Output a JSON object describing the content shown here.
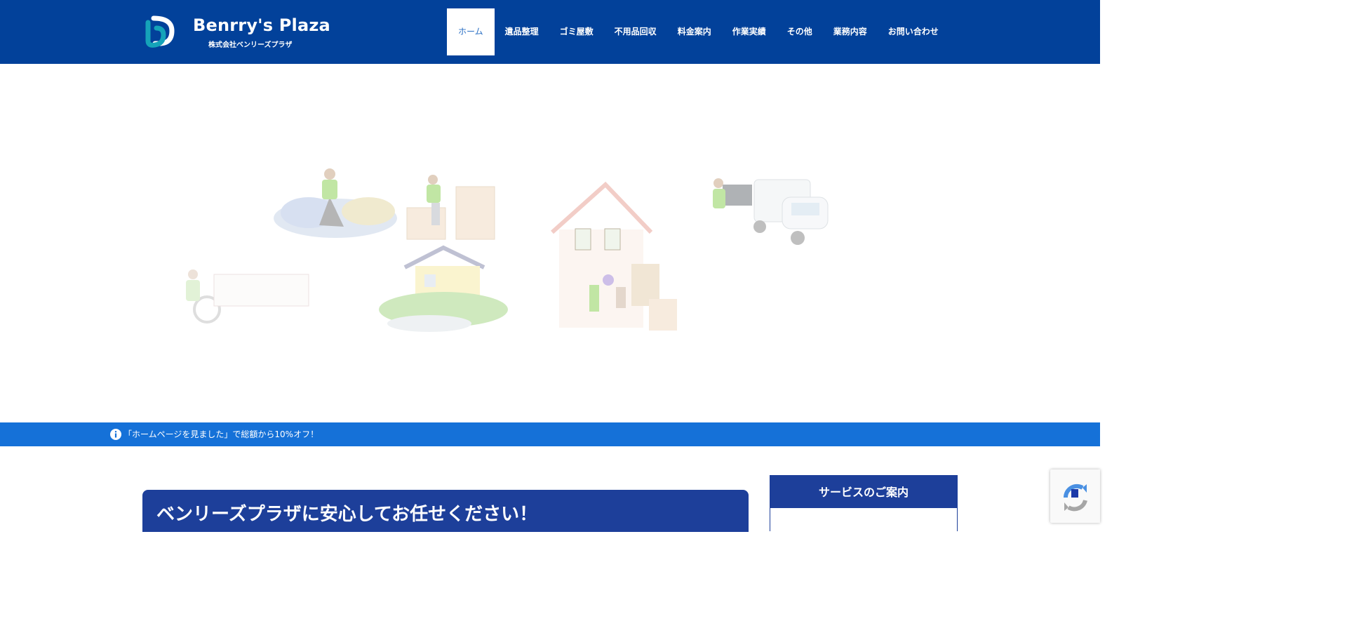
{
  "header": {
    "logo": {
      "name": "Benrry's Plaza",
      "subtitle": "株式会社ベンリーズプラザ"
    },
    "nav": [
      {
        "label": "ホーム",
        "active": true
      },
      {
        "label": "遺品整理"
      },
      {
        "label": "ゴミ屋敷"
      },
      {
        "label": "不用品回収"
      },
      {
        "label": "料金案内"
      },
      {
        "label": "作業実績"
      },
      {
        "label": "その他"
      },
      {
        "label": "業務内容"
      },
      {
        "label": "お問い合わせ"
      }
    ]
  },
  "notice": {
    "icon": "info-icon",
    "text": "「ホームページを見ました」で総額から10%オフ！"
  },
  "main": {
    "heading": "ベンリーズプラザに安心してお任せください！"
  },
  "sidebar": {
    "title": "サービスのご案内"
  },
  "colors": {
    "header": "#02419a",
    "notice": "#1571d8",
    "heading": "#1d3f9a"
  }
}
